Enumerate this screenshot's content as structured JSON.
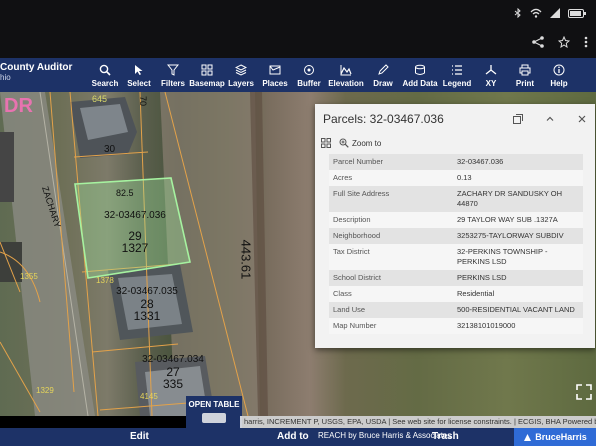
{
  "app": {
    "title": "County Auditor",
    "subtitle": "hio"
  },
  "toolbar": [
    {
      "icon": "search-icon",
      "label": "Search"
    },
    {
      "icon": "select-icon",
      "label": "Select"
    },
    {
      "icon": "filter-icon",
      "label": "Filters"
    },
    {
      "icon": "basemap-icon",
      "label": "Basemap"
    },
    {
      "icon": "layers-icon",
      "label": "Layers"
    },
    {
      "icon": "places-icon",
      "label": "Places"
    },
    {
      "icon": "buffer-icon",
      "label": "Buffer"
    },
    {
      "icon": "elevation-icon",
      "label": "Elevation"
    },
    {
      "icon": "draw-icon",
      "label": "Draw"
    },
    {
      "icon": "add-data-icon",
      "label": "Add Data"
    },
    {
      "icon": "legend-icon",
      "label": "Legend"
    },
    {
      "icon": "xy-icon",
      "label": "XY"
    },
    {
      "icon": "print-icon",
      "label": "Print"
    },
    {
      "icon": "help-icon",
      "label": "Help"
    }
  ],
  "map": {
    "street_label": "ZACHARY",
    "labels": [
      "645",
      "30",
      "82.5",
      "70",
      "443.61",
      "1378",
      "1355",
      "1329",
      "4145"
    ],
    "parcels": [
      {
        "id": "32-03467.036",
        "lot": "29",
        "addr": "1327"
      },
      {
        "id": "32-03467.035",
        "lot": "28",
        "addr": "1331"
      },
      {
        "id": "32-03467.034",
        "lot": "27",
        "addr": "335"
      }
    ],
    "street_letters": "DR"
  },
  "popup": {
    "title": "Parcels: 32-03467.036",
    "zoom_label": "Zoom to",
    "rows": [
      {
        "key": "Parcel Number",
        "value": "32-03467.036"
      },
      {
        "key": "Acres",
        "value": "0.13"
      },
      {
        "key": "Full Site Address",
        "value": "ZACHARY DR SANDUSKY OH 44870"
      },
      {
        "key": "Description",
        "value": "29 TAYLOR WAY SUB .1327A"
      },
      {
        "key": "Neighborhood",
        "value": "3253275-TAYLORWAY SUBDIV"
      },
      {
        "key": "Tax District",
        "value": "32-PERKINS TOWNSHIP - PERKINS LSD"
      },
      {
        "key": "School District",
        "value": "PERKINS LSD"
      },
      {
        "key": "Class",
        "value": "Residential"
      },
      {
        "key": "Land Use",
        "value": "500-RESIDENTIAL VACANT LAND"
      },
      {
        "key": "Map Number",
        "value": "32138101019000"
      }
    ]
  },
  "open_table": "OPEN TABLE",
  "attribution": "harris, INCREMENT P, USGS, EPA, USDA | See web site for license constraints. | ECGIS, BHA   Powered by Esri",
  "bottom": {
    "edit": "Edit",
    "add_to": "Add to",
    "credit": "REACH by Bruce Harris & Associates",
    "trash": "Trash",
    "brand": "BruceHarris"
  },
  "colors": {
    "header": "#1d3267",
    "parcel_outline": "#e3a24a",
    "selected_parcel": "#a6f2a0"
  }
}
